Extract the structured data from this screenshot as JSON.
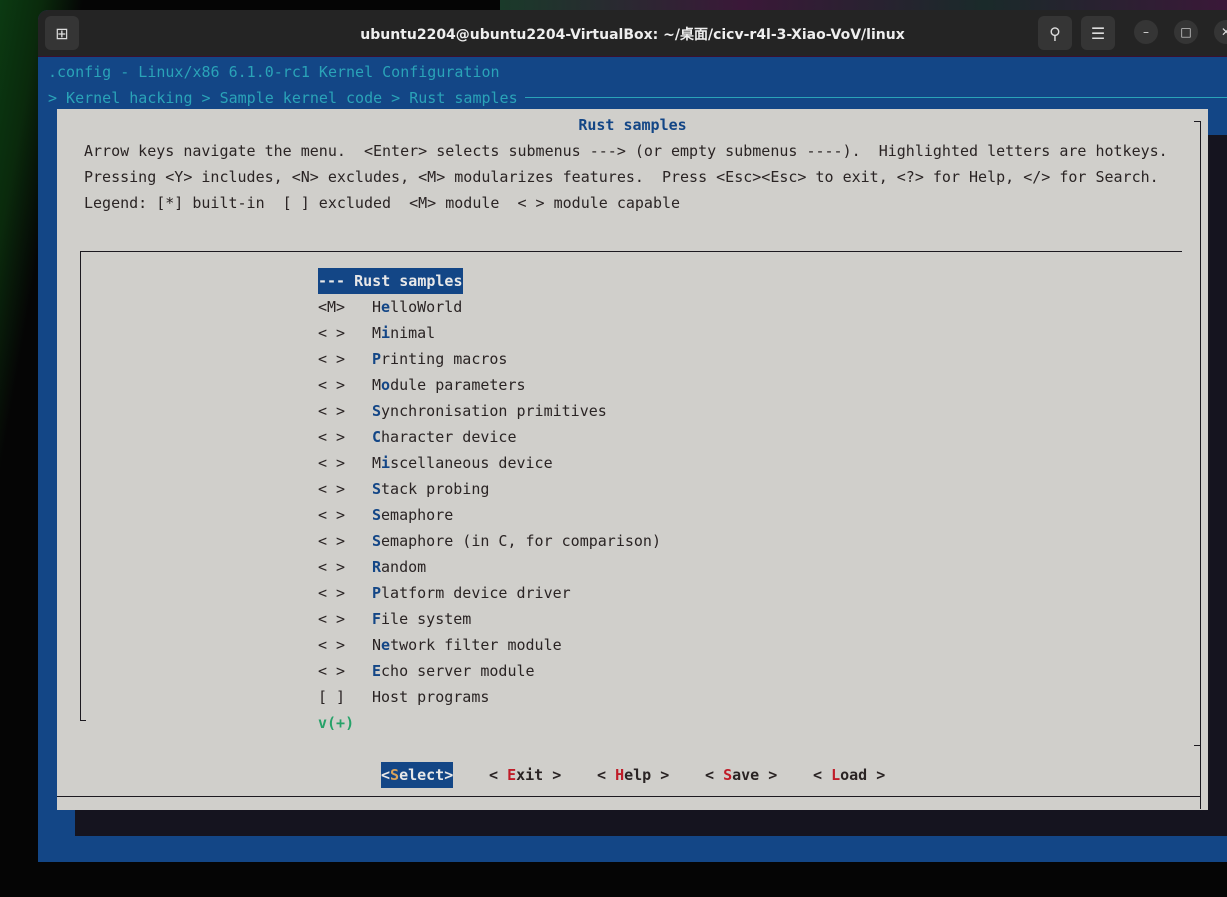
{
  "window": {
    "title": "ubuntu2204@ubuntu2204-VirtualBox: ~/桌面/cicv-r4l-3-Xiao-VoV/linux",
    "icons": [
      "new-tab-icon",
      "search-icon",
      "menu-icon",
      "minimize-icon",
      "maximize-icon",
      "close-icon"
    ]
  },
  "header": {
    "config": ".config - Linux/x86 6.1.0-rc1 Kernel Configuration",
    "breadcrumb": "> Kernel hacking > Sample kernel code > Rust samples"
  },
  "dialog": {
    "title": "Rust samples",
    "help": [
      "Arrow keys navigate the menu.  <Enter> selects submenus ---> (or empty submenus ----).  Highlighted letters are hotkeys.",
      "Pressing <Y> includes, <N> excludes, <M> modularizes features.  Press <Esc><Esc> to exit, <?> for Help, </> for Search.",
      "Legend: [*] built-in  [ ] excluded  <M> module  < > module capable"
    ],
    "menu_header": "--- Rust samples",
    "items": [
      {
        "state": "<M>",
        "pre": "H",
        "hk": "e",
        "rest": "lloWorld"
      },
      {
        "state": "< >",
        "pre": "M",
        "hk": "i",
        "rest": "nimal"
      },
      {
        "state": "< >",
        "pre": "",
        "hk": "P",
        "rest": "rinting macros"
      },
      {
        "state": "< >",
        "pre": "M",
        "hk": "o",
        "rest": "dule parameters"
      },
      {
        "state": "< >",
        "pre": "",
        "hk": "S",
        "rest": "ynchronisation primitives"
      },
      {
        "state": "< >",
        "pre": "",
        "hk": "C",
        "rest": "haracter device"
      },
      {
        "state": "< >",
        "pre": "M",
        "hk": "i",
        "rest": "scellaneous device"
      },
      {
        "state": "< >",
        "pre": "",
        "hk": "S",
        "rest": "tack probing"
      },
      {
        "state": "< >",
        "pre": "",
        "hk": "S",
        "rest": "emaphore"
      },
      {
        "state": "< >",
        "pre": "",
        "hk": "S",
        "rest": "emaphore (in C, for comparison)"
      },
      {
        "state": "< >",
        "pre": "",
        "hk": "R",
        "rest": "andom"
      },
      {
        "state": "< >",
        "pre": "",
        "hk": "P",
        "rest": "latform device driver"
      },
      {
        "state": "< >",
        "pre": "",
        "hk": "F",
        "rest": "ile system"
      },
      {
        "state": "< >",
        "pre": "N",
        "hk": "e",
        "rest": "twork filter module"
      },
      {
        "state": "< >",
        "pre": "",
        "hk": "E",
        "rest": "cho server module"
      },
      {
        "state": "[ ]",
        "pre": "",
        "hk": "",
        "rest": "Host programs"
      }
    ],
    "more": "v(+)",
    "buttons": [
      {
        "open": "<",
        "hk": "S",
        "rest": "elect",
        "close": ">"
      },
      {
        "open": "< ",
        "hk": "E",
        "rest": "xit",
        "close": " >"
      },
      {
        "open": "< ",
        "hk": "H",
        "rest": "elp",
        "close": " >"
      },
      {
        "open": "< ",
        "hk": "S",
        "rest": "ave",
        "close": " >"
      },
      {
        "open": "< ",
        "hk": "L",
        "rest": "oad",
        "close": " >"
      }
    ]
  }
}
